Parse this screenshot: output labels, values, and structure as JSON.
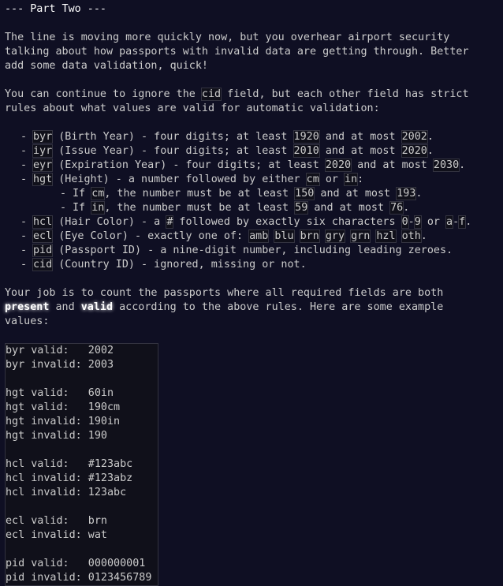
{
  "title": "--- Part Two ---",
  "intro": [
    "The line is moving more quickly now, but you overhear airport security",
    "talking about how passports with invalid data are getting through. Better",
    "add some data validation, quick!"
  ],
  "p2": {
    "pre": "You can continue to ignore the ",
    "code": "cid",
    "post_line1": " field, but each other field has strict",
    "line2": "rules about what values are valid for automatic validation:"
  },
  "rules": {
    "byr": {
      "code": "byr",
      "t1": " (Birth Year) - four digits; at least ",
      "c1": "1920",
      "t2": " and at most ",
      "c2": "2002",
      "t3": "."
    },
    "iyr": {
      "code": "iyr",
      "t1": " (Issue Year) - four digits; at least ",
      "c1": "2010",
      "t2": " and at most ",
      "c2": "2020",
      "t3": "."
    },
    "eyr": {
      "code": "eyr",
      "t1": " (Expiration Year) - four digits; at least ",
      "c1": "2020",
      "t2": " and at most ",
      "c2": "2030",
      "t3": "."
    },
    "hgt": {
      "code": "hgt",
      "t1": " (Height) - a number followed by either ",
      "c1": "cm",
      "t2": " or ",
      "c2": "in",
      "t3": ":"
    },
    "hgt_cm": {
      "t0": "If ",
      "c0": "cm",
      "t1": ", the number must be at least ",
      "c1": "150",
      "t2": " and at most ",
      "c2": "193",
      "t3": "."
    },
    "hgt_in": {
      "t0": "If ",
      "c0": "in",
      "t1": ", the number must be at least ",
      "c1": "59",
      "t2": " and at most ",
      "c2": "76",
      "t3": "."
    },
    "hcl": {
      "code": "hcl",
      "t1": " (Hair Color) - a ",
      "c1": "#",
      "t2": " followed by exactly six characters ",
      "c2": "0",
      "t3": "-",
      "c3": "9",
      "t4": " or ",
      "c4": "a",
      "t5": "-",
      "c5": "f",
      "t6": "."
    },
    "ecl": {
      "code": "ecl",
      "t1": " (Eye Color) - exactly one of: ",
      "opts": [
        "amb",
        "blu",
        "brn",
        "gry",
        "grn",
        "hzl",
        "oth"
      ],
      "t2": "."
    },
    "pid": {
      "code": "pid",
      "t1": " (Passport ID) - a nine-digit number, including leading zeroes."
    },
    "cid": {
      "code": "cid",
      "t1": " (Country ID) - ignored, missing or not."
    }
  },
  "p3": {
    "l1": "Your job is to count the passports where all required fields are both",
    "present": "present",
    "and": " and ",
    "valid": "valid",
    "l2_post": " according to the above rules. Here are some example",
    "l3": "values:"
  },
  "examples": [
    "byr valid:   2002",
    "byr invalid: 2003",
    "",
    "hgt valid:   60in",
    "hgt valid:   190cm",
    "hgt invalid: 190in",
    "hgt invalid: 190",
    "",
    "hcl valid:   #123abc",
    "hcl invalid: #123abz",
    "hcl invalid: 123abc",
    "",
    "ecl valid:   brn",
    "ecl invalid: wat",
    "",
    "pid valid:   000000001",
    "pid invalid: 0123456789"
  ]
}
